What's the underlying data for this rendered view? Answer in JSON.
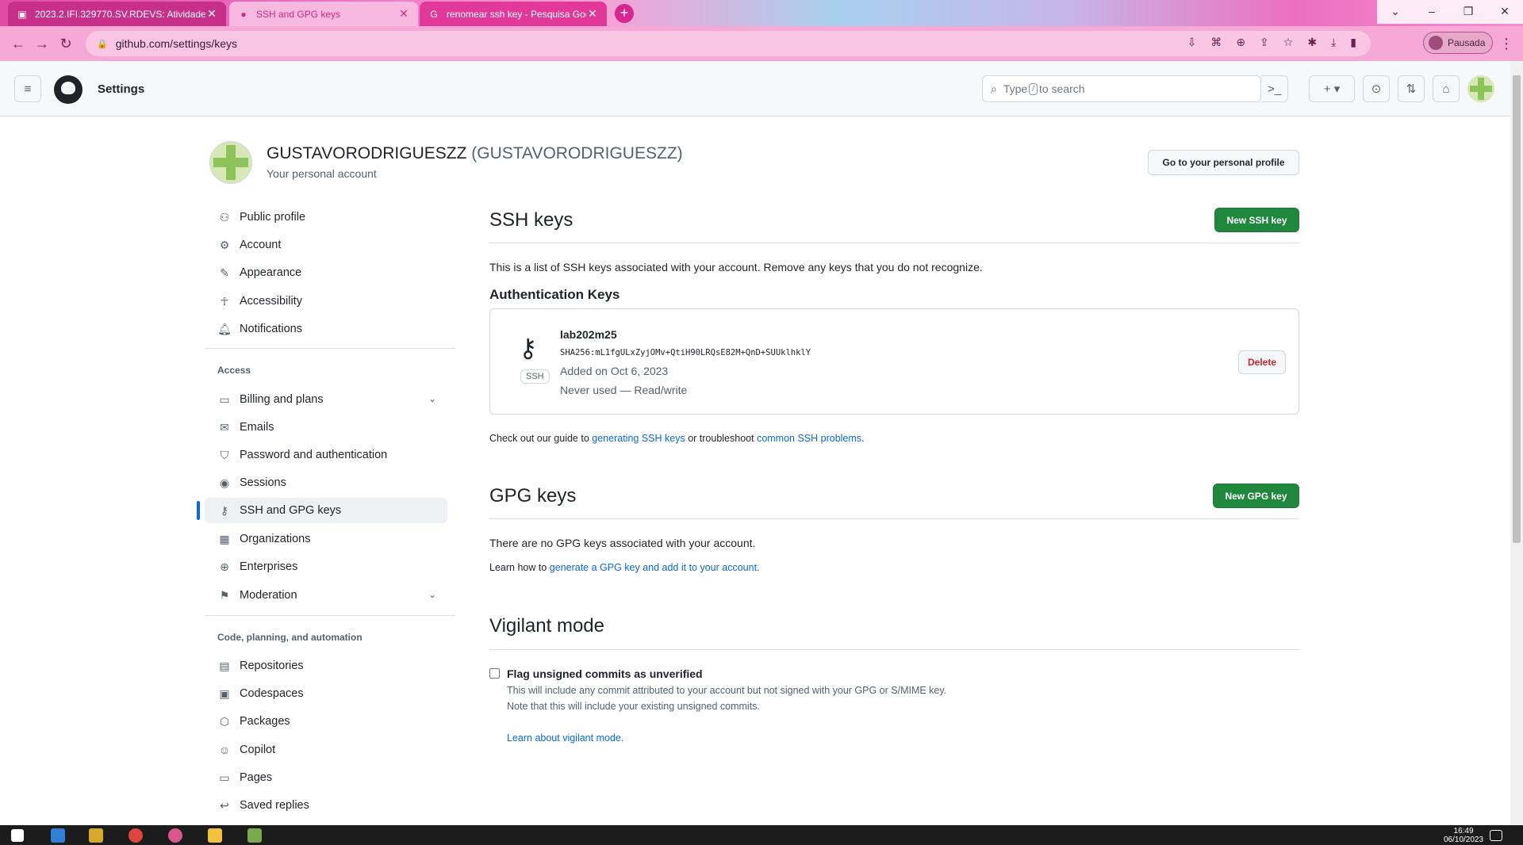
{
  "browser": {
    "tabs": [
      {
        "title": "2023.2.IFI.329770.SV.RDEVS: Atividades",
        "icon": "moodle-icon"
      },
      {
        "title": "SSH and GPG keys",
        "icon": "github-icon"
      },
      {
        "title": "renomear ssh key - Pesquisa Google",
        "icon": "google-icon"
      }
    ],
    "url": "github.com/settings/keys",
    "profile_label": "Pausada"
  },
  "header": {
    "title": "Settings",
    "search_placeholder_pre": "Type",
    "search_key": "/",
    "search_placeholder_post": "to search"
  },
  "account": {
    "name": "GUSTAVORODRIGUESZZ",
    "handle": "(GUSTAVORODRIGUESZZ)",
    "subtitle": "Your personal account",
    "profile_button": "Go to your personal profile"
  },
  "sidebar": {
    "items": [
      {
        "label": "Public profile",
        "icon": "person-icon"
      },
      {
        "label": "Account",
        "icon": "gear-icon"
      },
      {
        "label": "Appearance",
        "icon": "paintbrush-icon"
      },
      {
        "label": "Accessibility",
        "icon": "accessibility-icon"
      },
      {
        "label": "Notifications",
        "icon": "bell-icon"
      }
    ],
    "access_header": "Access",
    "access_items": [
      {
        "label": "Billing and plans",
        "icon": "credit-card-icon"
      },
      {
        "label": "Emails",
        "icon": "mail-icon"
      },
      {
        "label": "Password and authentication",
        "icon": "shield-icon"
      },
      {
        "label": "Sessions",
        "icon": "broadcast-icon"
      },
      {
        "label": "SSH and GPG keys",
        "icon": "key-icon"
      },
      {
        "label": "Organizations",
        "icon": "organization-icon"
      },
      {
        "label": "Enterprises",
        "icon": "globe-icon"
      },
      {
        "label": "Moderation",
        "icon": "report-icon"
      }
    ],
    "code_header": "Code, planning, and automation",
    "code_items": [
      {
        "label": "Repositories",
        "icon": "repo-icon"
      },
      {
        "label": "Codespaces",
        "icon": "codespaces-icon"
      },
      {
        "label": "Packages",
        "icon": "package-icon"
      },
      {
        "label": "Copilot",
        "icon": "copilot-icon"
      },
      {
        "label": "Pages",
        "icon": "browser-icon"
      },
      {
        "label": "Saved replies",
        "icon": "reply-icon"
      }
    ]
  },
  "ssh": {
    "title": "SSH keys",
    "new_button": "New SSH key",
    "description": "This is a list of SSH keys associated with your account. Remove any keys that you do not recognize.",
    "auth_header": "Authentication Keys",
    "key": {
      "name": "lab202m25",
      "fingerprint": "SHA256:mL1fgULxZyjOMv+QtiH90LRQsE82M+QnD+SUUklhklY",
      "added": "Added on Oct 6, 2023",
      "usage": "Never used — Read/write",
      "badge": "SSH",
      "delete_label": "Delete"
    },
    "guide_pre": "Check out our guide to",
    "guide_link1": "generating SSH keys",
    "guide_mid": "or troubleshoot",
    "guide_link2": "common SSH problems",
    "guide_end": "."
  },
  "gpg": {
    "title": "GPG keys",
    "new_button": "New GPG key",
    "empty": "There are no GPG keys associated with your account.",
    "learn_pre": "Learn how to",
    "learn_link": "generate a GPG key and add it to your account",
    "learn_end": "."
  },
  "vigilant": {
    "title": "Vigilant mode",
    "checkbox_label": "Flag unsigned commits as unverified",
    "checked": false,
    "desc1": "This will include any commit attributed to your account but not signed with your GPG or S/MIME key.",
    "desc2": "Note that this will include your existing unsigned commits.",
    "learn_link": "Learn about vigilant mode."
  },
  "taskbar": {
    "time": "16:49",
    "date": "06/10/2023"
  },
  "colors": {
    "accent": "#0969da",
    "primary_button": "#1f883d",
    "danger": "#cf222e"
  }
}
